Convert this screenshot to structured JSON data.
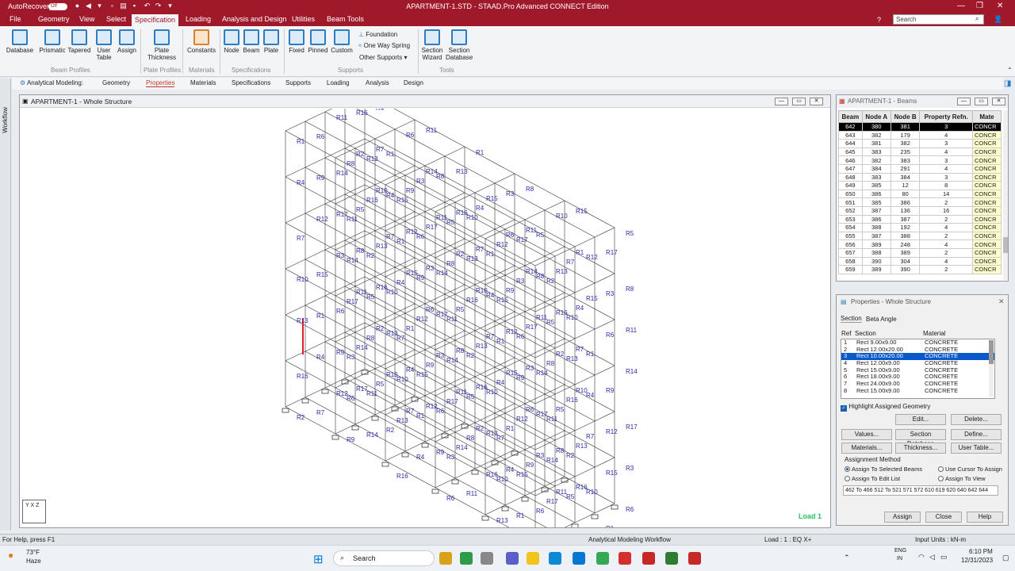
{
  "titlebar": {
    "autorecovery": "AutoRecovery",
    "toggle": "Off",
    "title": "APARTMENT-1.STD - STAAD.Pro Advanced CONNECT Edition"
  },
  "menu": {
    "items": [
      "File",
      "Geometry",
      "View",
      "Select",
      "Specification",
      "Loading",
      "Analysis and Design",
      "Utilities",
      "Beam Tools"
    ],
    "active": "Specification"
  },
  "search": {
    "placeholder": "Search"
  },
  "ribbon": {
    "buttons": [
      "Database",
      "Prismatic",
      "Tapered",
      "User Table",
      "Assign",
      "Plate Thickness",
      "Constants",
      "Node",
      "Beam",
      "Plate",
      "Fixed",
      "Pinned",
      "Custom",
      "Section Wizard",
      "Section Database"
    ],
    "small": [
      "Foundation",
      "One Way Spring",
      "Other Supports"
    ],
    "groups": [
      "Beam Profiles",
      "Plate Profiles",
      "Materials",
      "Specifications",
      "Supports",
      "Tools"
    ]
  },
  "workflow": {
    "label": "Workflow"
  },
  "pagetabs": {
    "prefix": "Analytical Modeling:",
    "items": [
      "Geometry",
      "Properties",
      "Materials",
      "Specifications",
      "Supports",
      "Loading",
      "Analysis",
      "Design"
    ],
    "active": "Properties"
  },
  "viewport": {
    "title": "APARTMENT-1 - Whole Structure",
    "load_label": "Load 1",
    "axis": "Y X Z",
    "accent": "#2a2aa8"
  },
  "beams": {
    "title": "APARTMENT-1 - Beams",
    "headers": [
      "Beam",
      "Node A",
      "Node B",
      "Property Refn.",
      "Mate"
    ],
    "rows": [
      [
        "642",
        "380",
        "381",
        "3",
        "CONCR"
      ],
      [
        "643",
        "382",
        "179",
        "4",
        "CONCR"
      ],
      [
        "644",
        "381",
        "382",
        "3",
        "CONCR"
      ],
      [
        "645",
        "383",
        "235",
        "4",
        "CONCR"
      ],
      [
        "646",
        "382",
        "383",
        "3",
        "CONCR"
      ],
      [
        "647",
        "384",
        "291",
        "4",
        "CONCR"
      ],
      [
        "648",
        "383",
        "384",
        "3",
        "CONCR"
      ],
      [
        "649",
        "385",
        "12",
        "8",
        "CONCR"
      ],
      [
        "650",
        "386",
        "80",
        "14",
        "CONCR"
      ],
      [
        "651",
        "385",
        "386",
        "2",
        "CONCR"
      ],
      [
        "652",
        "387",
        "136",
        "16",
        "CONCR"
      ],
      [
        "653",
        "386",
        "387",
        "2",
        "CONCR"
      ],
      [
        "654",
        "388",
        "192",
        "4",
        "CONCR"
      ],
      [
        "655",
        "387",
        "388",
        "2",
        "CONCR"
      ],
      [
        "656",
        "389",
        "248",
        "4",
        "CONCR"
      ],
      [
        "657",
        "388",
        "389",
        "2",
        "CONCR"
      ],
      [
        "658",
        "390",
        "304",
        "4",
        "CONCR"
      ],
      [
        "659",
        "389",
        "390",
        "2",
        "CONCR"
      ]
    ]
  },
  "props": {
    "title": "Properties - Whole Structure",
    "tabs": [
      "Section",
      "Beta Angle"
    ],
    "cols": [
      "Ref",
      "Section",
      "Material"
    ],
    "rows": [
      [
        "1",
        "Rect 9.00x9.00",
        "CONCRETE"
      ],
      [
        "2",
        "Rect 12.00x20.00",
        "CONCRETE"
      ],
      [
        "3",
        "Rect 10.00x20.00",
        "CONCRETE"
      ],
      [
        "4",
        "Rect 12.00x9.00",
        "CONCRETE"
      ],
      [
        "5",
        "Rect 15.00x9.00",
        "CONCRETE"
      ],
      [
        "6",
        "Rect 18.00x9.00",
        "CONCRETE"
      ],
      [
        "7",
        "Rect 24.00x9.00",
        "CONCRETE"
      ],
      [
        "8",
        "Rect 15.00x9.00",
        "CONCRETE"
      ]
    ],
    "highlight": "Highlight Assigned Geometry",
    "btn_edit": "Edit...",
    "btn_delete": "Delete...",
    "btn_values": "Values...",
    "btn_secdb": "Section Database",
    "btn_define": "Define...",
    "btn_materials": "Materials...",
    "btn_thickness": "Thickness...",
    "btn_usertable": "User Table...",
    "assign_method": "Assignment Method",
    "opt1": "Assign To Selected Beams",
    "opt2": "Assign To Edit List",
    "opt3": "Use Cursor To Assign",
    "opt4": "Assign To View",
    "editlist": "462 To 466 512 To 521 571 572 610 619 620 640 642 644",
    "btn_assign": "Assign",
    "btn_close": "Close",
    "btn_help": "Help"
  },
  "status": {
    "help": "For Help, press F1",
    "workflow": "Analytical Modeling Workflow",
    "load": "Load : 1 : EQ X+",
    "units": "Input Units : kN-m"
  },
  "taskbar": {
    "temp": "73°F",
    "weather": "Haze",
    "search": "Search",
    "lang1": "ENG",
    "lang2": "IN",
    "time": "6:10 PM",
    "date": "12/31/2023"
  }
}
